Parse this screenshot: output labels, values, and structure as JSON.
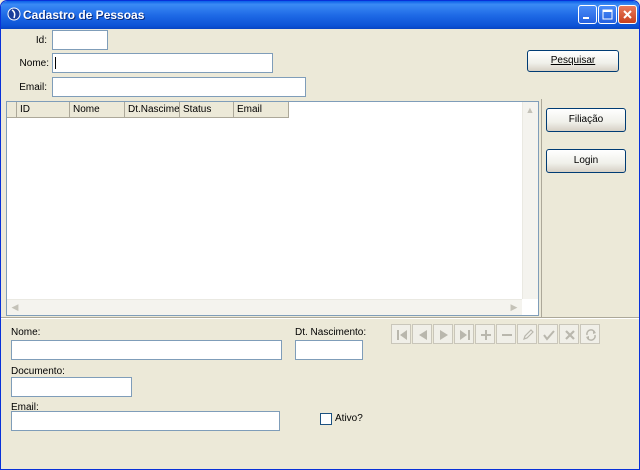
{
  "window": {
    "title": "Cadastro de Pessoas"
  },
  "search": {
    "id_label": "Id:",
    "id_value": "",
    "nome_label": "Nome:",
    "nome_value": "",
    "email_label": "Email:",
    "email_value": "",
    "search_button": "Pesquisar"
  },
  "grid": {
    "columns": [
      "ID",
      "Nome",
      "Dt.Nascimer",
      "Status",
      "Email"
    ],
    "rows": []
  },
  "side_buttons": {
    "filiacao": "Filiação",
    "login": "Login"
  },
  "form": {
    "nome_label": "Nome:",
    "nome_value": "",
    "nascimento_label": "Dt. Nascimento:",
    "nascimento_value": "",
    "documento_label": "Documento:",
    "documento_value": "",
    "email_label": "Email:",
    "email_value": "",
    "ativo_label": "Ativo?",
    "ativo_checked": false
  },
  "navigator": {
    "buttons": [
      "first-icon",
      "prior-icon",
      "next-icon",
      "last-icon",
      "insert-icon",
      "delete-icon",
      "edit-icon",
      "post-icon",
      "cancel-icon",
      "refresh-icon"
    ],
    "enabled": false
  },
  "colors": {
    "titlebar": "#0c53d6",
    "face": "#ece9d8",
    "border": "#7f9db9",
    "disabled_icon": "#b9b7ad"
  }
}
